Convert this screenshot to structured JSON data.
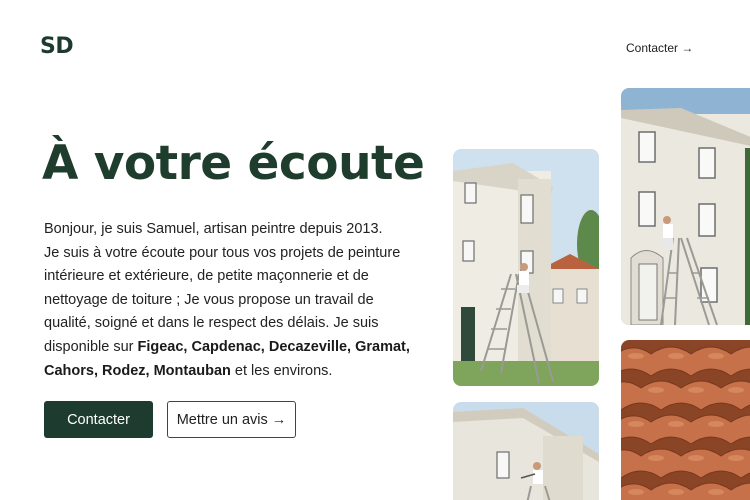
{
  "header": {
    "logo": "SD",
    "contact_link": "Contacter →"
  },
  "hero": {
    "title": "À votre écoute",
    "intro_lines": [
      "Bonjour, je suis Samuel, artisan peintre depuis 2013.",
      "Je suis à votre écoute pour tous vos projets de peinture",
      "intérieure et extérieure, de petite maçonnerie et de",
      "nettoyage de toiture ; Je vous propose un travail de",
      "qualité, soigné et dans le respect des délais. Je suis"
    ],
    "intro_line6_prefix": "disponible sur ",
    "intro_line6_bold": "Figeac, Capdenac, Decazeville, Gramat,",
    "intro_line7_bold": "Cahors, Rodez, Montauban",
    "intro_line7_suffix": " et les environs.",
    "primary_button": "Contacter",
    "secondary_button": "Mettre un avis →"
  },
  "gallery": {
    "photos": [
      "painter-on-ladder-house",
      "painter-on-ladder-facade",
      "painter-roof-edge",
      "terracotta-roof-tiles"
    ]
  },
  "colors": {
    "brand_green": "#1d3b2e",
    "title_green": "#1f3d2c"
  }
}
